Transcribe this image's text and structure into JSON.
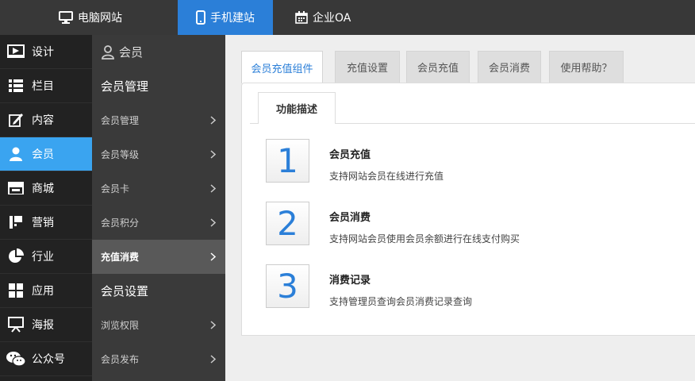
{
  "topbar": {
    "tabs": [
      {
        "label": "电脑网站",
        "icon": "monitor-icon",
        "active": false
      },
      {
        "label": "手机建站",
        "icon": "mobile-icon",
        "active": true
      },
      {
        "label": "企业OA",
        "icon": "calendar-icon",
        "active": false
      }
    ]
  },
  "leftnav": {
    "items": [
      {
        "label": "设计",
        "icon": "design-icon"
      },
      {
        "label": "栏目",
        "icon": "list-icon"
      },
      {
        "label": "内容",
        "icon": "edit-icon"
      },
      {
        "label": "会员",
        "icon": "user-icon",
        "active": true
      },
      {
        "label": "商城",
        "icon": "store-icon"
      },
      {
        "label": "营销",
        "icon": "marketing-icon"
      },
      {
        "label": "行业",
        "icon": "pie-chart-icon"
      },
      {
        "label": "应用",
        "icon": "apps-grid-icon"
      },
      {
        "label": "海报",
        "icon": "poster-icon"
      },
      {
        "label": "公众号",
        "icon": "wechat-icon"
      }
    ]
  },
  "subnav": {
    "header": "会员",
    "group1": "会员管理",
    "group1_items": [
      {
        "label": "会员管理"
      },
      {
        "label": "会员等级"
      },
      {
        "label": "会员卡"
      },
      {
        "label": "会员积分"
      },
      {
        "label": "充值消费",
        "active": true
      }
    ],
    "group2": "会员设置",
    "group2_items": [
      {
        "label": "浏览权限"
      },
      {
        "label": "会员发布"
      }
    ]
  },
  "main": {
    "tabs": [
      {
        "label": "会员充值组件",
        "active": true
      },
      {
        "label": "充值设置"
      },
      {
        "label": "会员充值"
      },
      {
        "label": "会员消费"
      },
      {
        "label": "使用帮助？"
      }
    ],
    "inner_tab": "功能描述",
    "features": [
      {
        "number": "1",
        "title": "会员充值",
        "desc": "支持网站会员在线进行充值"
      },
      {
        "number": "2",
        "title": "会员消费",
        "desc": "支持网站会员使用会员余额进行在线支付购买"
      },
      {
        "number": "3",
        "title": "消费记录",
        "desc": "支持管理员查询会员消费记录查询"
      }
    ]
  },
  "colors": {
    "accent_blue": "#2b7fd8",
    "active_nav": "#3aa4f0",
    "topbar_bg": "#383838",
    "leftnav_bg": "#222222",
    "subnav_bg": "#3a3a3a"
  }
}
